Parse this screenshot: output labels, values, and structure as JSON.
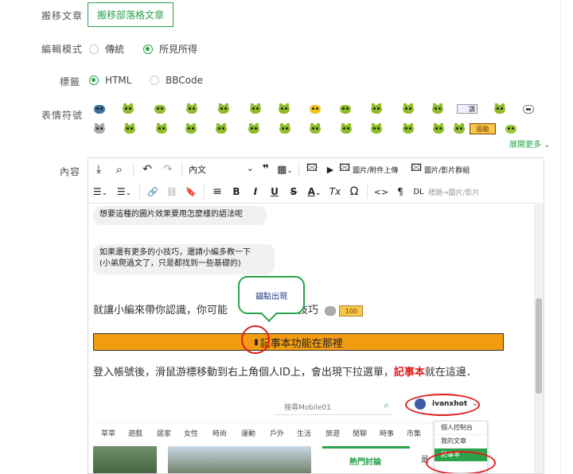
{
  "form": {
    "move_label": "搬移文章",
    "move_button": "搬移部落格文章",
    "mode_label": "編輯模式",
    "mode_options": [
      "傳統",
      "所見所得"
    ],
    "mode_selected": "所見所得",
    "tag_label": "標籤",
    "tag_options": [
      "HTML",
      "BBCode"
    ],
    "tag_selected": "HTML",
    "emoji_label": "表情符號",
    "emoji_extra": [
      "讚",
      "圖勵"
    ],
    "expand_more": "展開更多 ⌄",
    "content_label": "內容"
  },
  "toolbar": {
    "row1": {
      "download": "⤓",
      "search": "⌕",
      "undo": "↶",
      "redo": "↷",
      "paragraph_select": "內文",
      "quote": "❞",
      "table": "▦",
      "image": "🖾",
      "video": "▶",
      "image_upload": "圖片/附件上傳",
      "image_group": "圖片/影片群組"
    },
    "row2": {
      "bullet_list": "☰",
      "number_list": "☰",
      "link": "🔗",
      "unlink": "⛓",
      "bookmark": "🔖",
      "align": "≡",
      "bold": "B",
      "italic": "I",
      "underline": "U",
      "strike": "S",
      "font_color": "A",
      "clear_format": "Tx",
      "omega": "Ω",
      "code": "<>",
      "pilcrow": "¶",
      "dl": "DL",
      "caption_placeholder": "標題→圖片/影片"
    }
  },
  "content": {
    "bubble1": "想要這種的圖片效果要用怎麼樣的語法呢",
    "bubble2_line1": "如果還有更多的小技巧，還請小編多教一下",
    "bubble2_line2": "(小弟爬過文了，只是都找到一些基礎的)",
    "callout": "錨點出現",
    "intro_a": "就讓小編來帶你認識，你可能",
    "intro_b": "文小技巧",
    "badge_100": "100",
    "heading": "記事本功能在那裡",
    "instruction_a": "登入帳號後，滑鼠游標移動到右上角個人ID上，會出現下拉選單，",
    "instruction_em": "記事本",
    "instruction_b": "就在這邊．"
  },
  "screenshot": {
    "search_placeholder": "搜尋Mobile01",
    "username": "ivanxhot",
    "nav": [
      "草草",
      "遊戲",
      "居家",
      "女性",
      "時尚",
      "運動",
      "戶外",
      "生活",
      "旅遊",
      "閒聊",
      "時事",
      "市集"
    ],
    "hot_topics": "熱門討論",
    "partial_tab": "最",
    "menu": [
      "個人控制台",
      "我的文章",
      "記事本"
    ]
  },
  "colors": {
    "green": "#2aa24a",
    "orange": "#f39c12",
    "red_ring": "#e01c1c",
    "note_red": "#e01c1c"
  }
}
